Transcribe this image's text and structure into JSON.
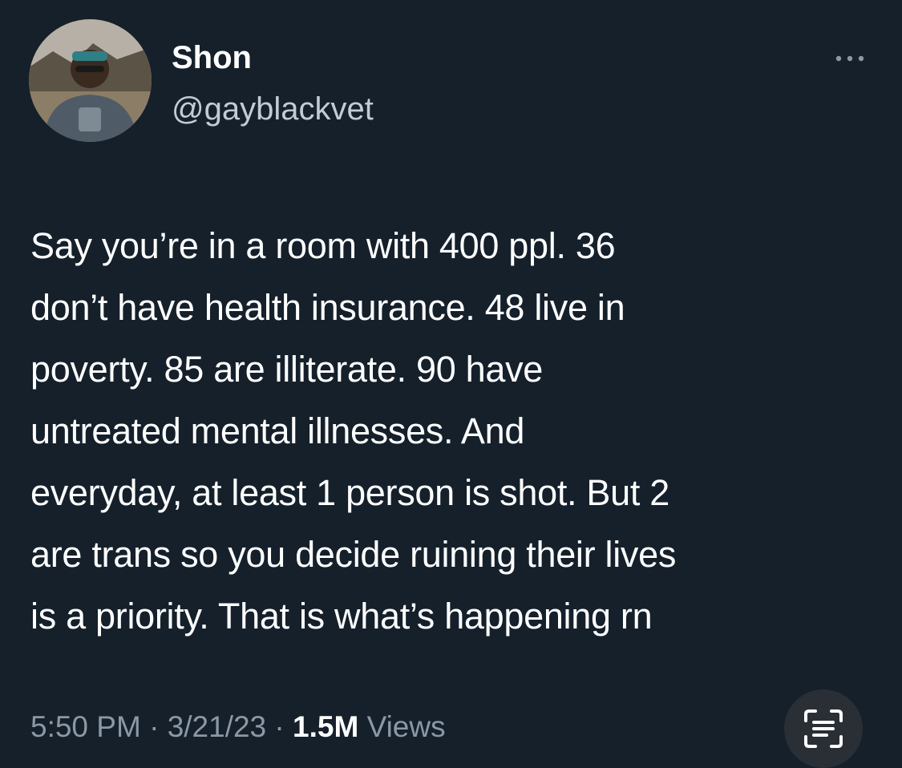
{
  "tweet": {
    "author": {
      "display_name": "Shon",
      "handle": "@gayblackvet"
    },
    "text": "Say you’re in a room with 400 ppl. 36\ndon’t have health insurance. 48 live in\npoverty. 85 are illiterate. 90 have\nuntreated mental illnesses. And\neveryday, at least 1 person is shot. But 2\nare trans so you decide ruining their lives\nis a priority. That is what’s happening rn",
    "time": "5:50 PM",
    "date": "3/21/23",
    "separator": " · ",
    "views_count": "1.5M",
    "views_label": " Views"
  },
  "icons": {
    "more": "more-horizontal-icon",
    "scan": "scan-text-icon"
  },
  "colors": {
    "background": "#15202b",
    "text": "#ffffff",
    "secondary_text": "#8b98a5"
  }
}
